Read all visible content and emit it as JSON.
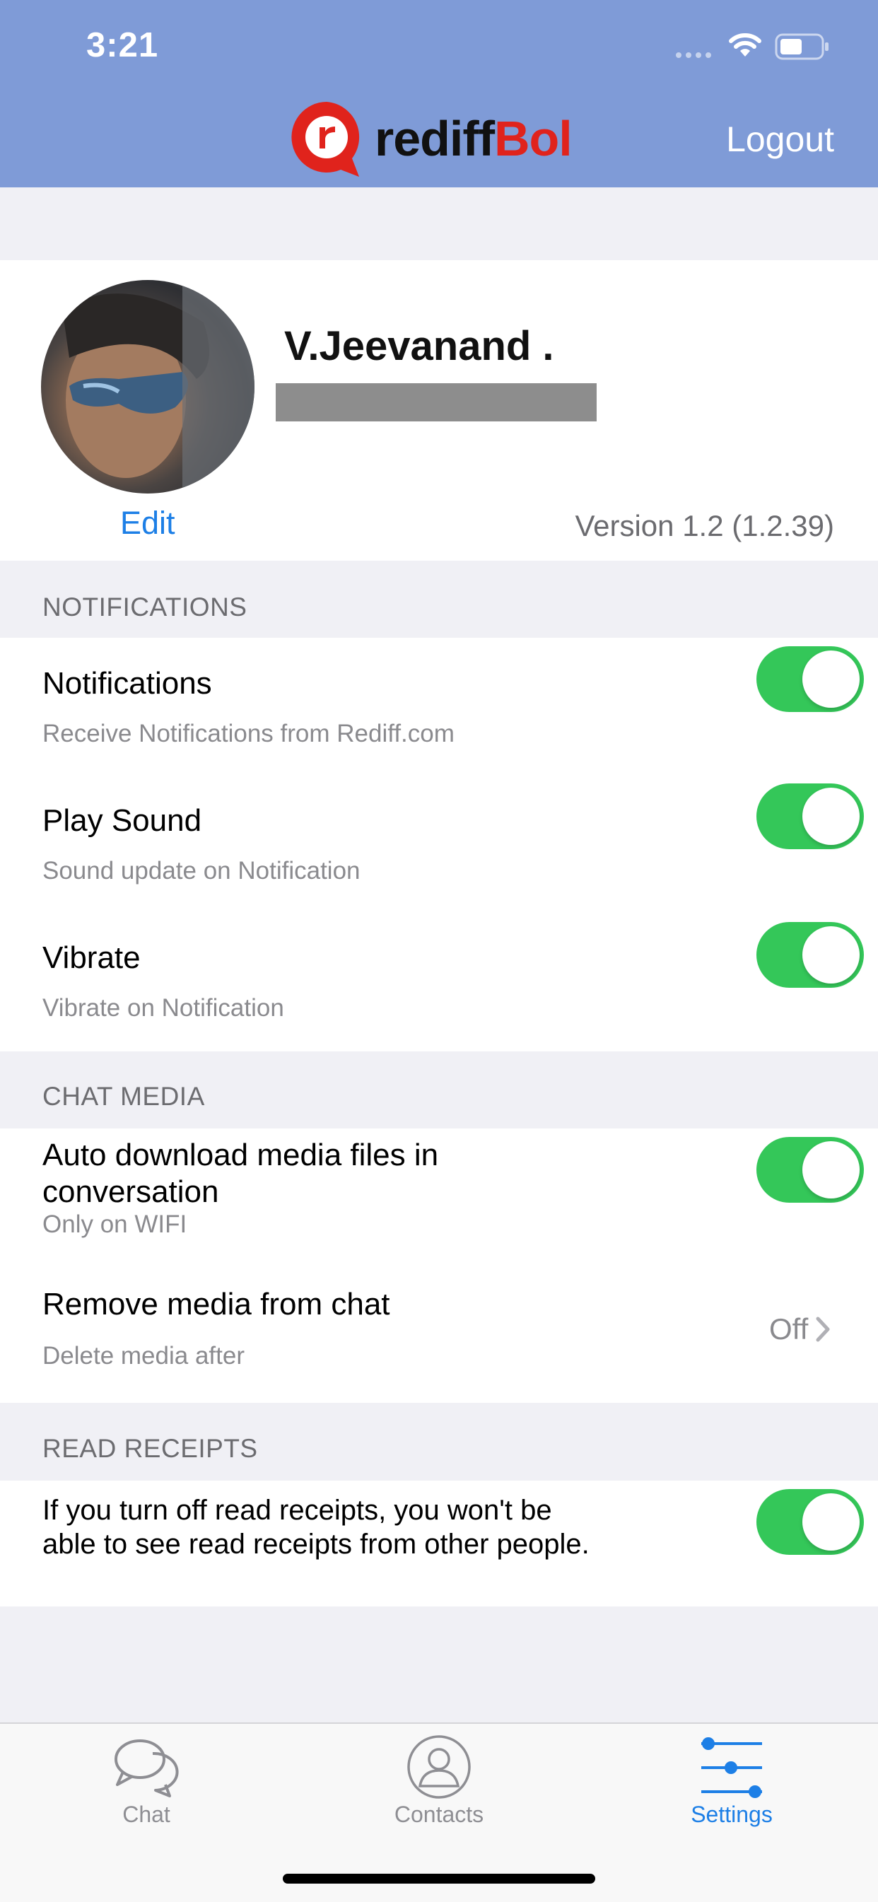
{
  "status_bar": {
    "time": "3:21"
  },
  "header": {
    "logo_text_dark": "rediff",
    "logo_text_red": "Bol",
    "logout_label": "Logout"
  },
  "profile": {
    "name": "V.Jeevanand .",
    "edit_label": "Edit",
    "version": "Version 1.2 (1.2.39)"
  },
  "sections": {
    "notifications": {
      "header": "NOTIFICATIONS",
      "rows": [
        {
          "title": "Notifications",
          "subtitle": "Receive Notifications from Rediff.com",
          "enabled": true
        },
        {
          "title": "Play Sound",
          "subtitle": "Sound update on Notification",
          "enabled": true
        },
        {
          "title": "Vibrate",
          "subtitle": "Vibrate on Notification",
          "enabled": true
        }
      ]
    },
    "chat_media": {
      "header": "CHAT MEDIA",
      "auto_download": {
        "title_line1": "Auto download media files in",
        "title_line2": "conversation",
        "subtitle": "Only on WIFI",
        "enabled": true
      },
      "remove_media": {
        "title": "Remove media from chat",
        "subtitle": "Delete media after",
        "value": "Off"
      }
    },
    "read_receipts": {
      "header": "READ RECEIPTS",
      "text_line1": "If you turn off read receipts, you won't be",
      "text_line2": "able to see read receipts from other people.",
      "enabled": true
    }
  },
  "tabbar": {
    "tabs": [
      {
        "label": "Chat",
        "icon": "chat-bubbles-icon",
        "active": false
      },
      {
        "label": "Contacts",
        "icon": "contact-person-icon",
        "active": false
      },
      {
        "label": "Settings",
        "icon": "sliders-icon",
        "active": true
      }
    ]
  },
  "colors": {
    "header_bg": "#7f9bd7",
    "toggle_on": "#34c759",
    "accent_blue": "#1d7fe6",
    "brand_red": "#e0231c"
  }
}
